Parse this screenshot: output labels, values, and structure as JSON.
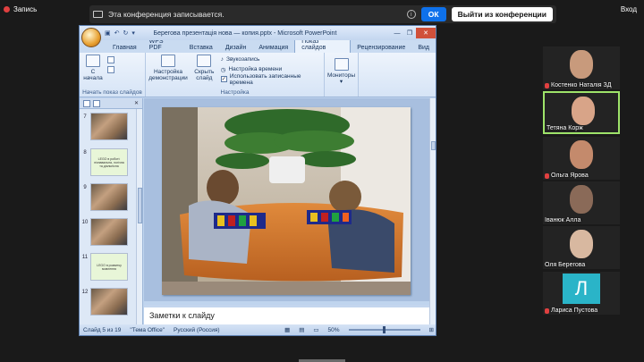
{
  "zoom": {
    "recording_label": "Запись",
    "enter_label": "Вход",
    "banner_text": "Эта конференция записывается.",
    "ok_label": "ОК",
    "leave_label": "Выйти из конференции"
  },
  "ppt": {
    "window_title": "Берегова презентація нова — копия.pptx - Microsoft PowerPoint",
    "tabs": [
      "Главная",
      "WPS PDF",
      "Вставка",
      "Дизайн",
      "Анимация",
      "Показ слайдов",
      "Рецензирование",
      "Вид"
    ],
    "ribbon": {
      "start_from_label": "С начала",
      "group1_title": "Начать показ слайдов",
      "setup_label": "Настройка демонстрации",
      "hide_label": "Скрыть слайд",
      "record_sound_label": "Звукозапись",
      "rehearse_label": "Настройка времени",
      "use_timings_label": "Использовать записанные времена",
      "group2_title": "Настройка",
      "monitors_label": "Мониторы"
    },
    "thumbnails": [
      {
        "num": "7",
        "kind": "photo",
        "text": ""
      },
      {
        "num": "8",
        "kind": "green",
        "text": "LEGO в роботі: пізнавальна, логічна та діяльнісна"
      },
      {
        "num": "9",
        "kind": "photo",
        "text": ""
      },
      {
        "num": "10",
        "kind": "photo",
        "text": ""
      },
      {
        "num": "11",
        "kind": "green",
        "text": "LEGO в розвитку мовлення"
      },
      {
        "num": "12",
        "kind": "photo",
        "text": ""
      }
    ],
    "notes_placeholder": "Заметки к слайду",
    "status": {
      "slide_info": "Слайд 5 из 19",
      "theme": "\"Тема Office\"",
      "language": "Русский (Россия)",
      "zoom": "50%"
    }
  },
  "participants": [
    {
      "name": "Костенко Наталія ЗД",
      "muted": true,
      "face": "#c89a7c"
    },
    {
      "name": "Тетяна Корж",
      "muted": false,
      "face": "#d8a488",
      "active": true
    },
    {
      "name": "Ольга Ярова",
      "muted": true,
      "face": "#c48a6c"
    },
    {
      "name": "Іванюк Алла",
      "muted": false,
      "face": "#8a6a58"
    },
    {
      "name": "Оля Берегова",
      "muted": false,
      "face": "#d8b8a0"
    },
    {
      "name": "Лариса Пустова",
      "muted": true,
      "avatar_letter": "Л"
    }
  ]
}
